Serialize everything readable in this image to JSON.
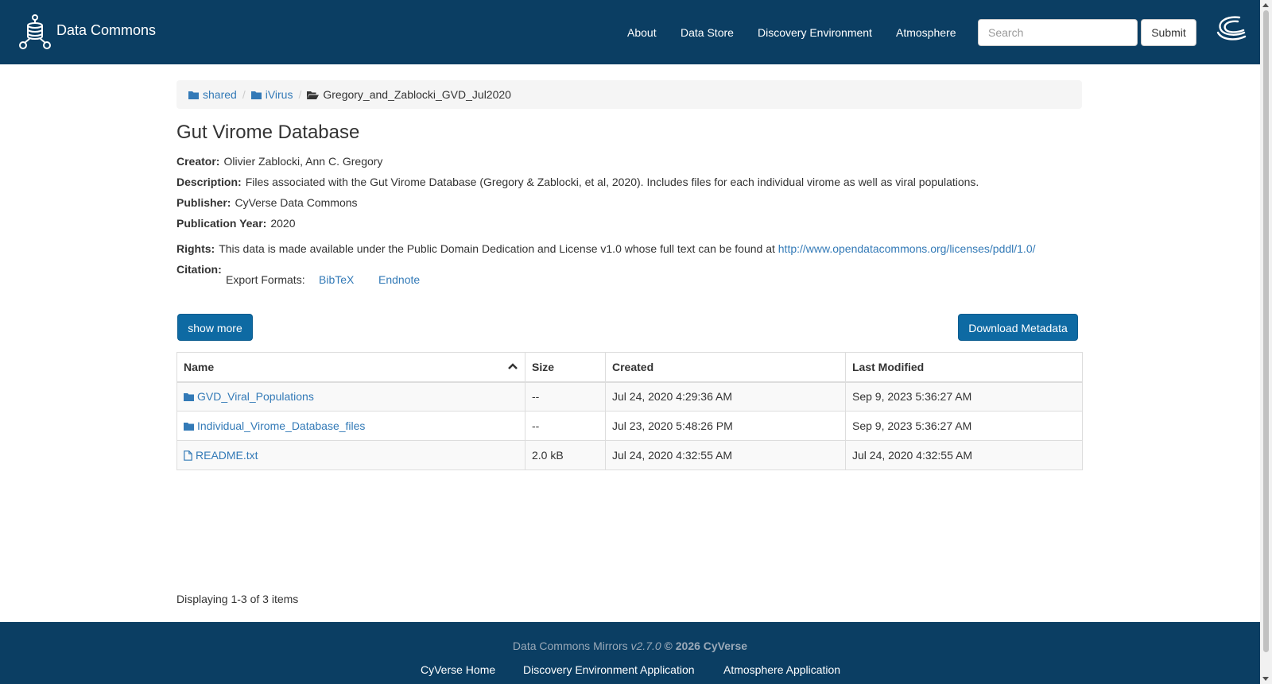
{
  "header": {
    "brand": "Data Commons",
    "nav": [
      "About",
      "Data Store",
      "Discovery Environment",
      "Atmosphere"
    ],
    "search_placeholder": "Search",
    "submit_label": "Submit"
  },
  "breadcrumb": {
    "items": [
      "shared",
      "iVirus"
    ],
    "current": "Gregory_and_Zablocki_GVD_Jul2020"
  },
  "dataset": {
    "title": "Gut Virome Database",
    "creator_label": "Creator:",
    "creator": "Olivier Zablocki, Ann C. Gregory",
    "description_label": "Description:",
    "description": "Files associated with the Gut Virome Database (Gregory & Zablocki, et al, 2020). Includes files for each individual virome as well as viral populations.",
    "publisher_label": "Publisher:",
    "publisher": "CyVerse Data Commons",
    "year_label": "Publication Year:",
    "year": "2020",
    "rights_label": "Rights:",
    "rights_text": "This data is made available under the Public Domain Dedication and License v1.0 whose full text can be found at",
    "rights_link": "http://www.opendatacommons.org/licenses/pddl/1.0/",
    "citation_label": "Citation:",
    "export_label": "Export Formats:",
    "export_formats": [
      "BibTeX",
      "Endnote"
    ]
  },
  "buttons": {
    "show_more": "show more",
    "download_metadata": "Download Metadata"
  },
  "table": {
    "columns": [
      "Name",
      "Size",
      "Created",
      "Last Modified"
    ],
    "rows": [
      {
        "name": "GVD_Viral_Populations",
        "type": "folder",
        "size": "--",
        "created": "Jul 24, 2020 4:29:36 AM",
        "modified": "Sep 9, 2023 5:36:27 AM"
      },
      {
        "name": "Individual_Virome_Database_files",
        "type": "folder",
        "size": "--",
        "created": "Jul 23, 2020 5:48:26 PM",
        "modified": "Sep 9, 2023 5:36:27 AM"
      },
      {
        "name": "README.txt",
        "type": "file",
        "size": "2.0 kB",
        "created": "Jul 24, 2020 4:32:55 AM",
        "modified": "Jul 24, 2020 4:32:55 AM"
      }
    ]
  },
  "displaying": "Displaying 1-3 of 3 items",
  "footer": {
    "app_name": "Data Commons Mirrors",
    "version": "v2.7.0",
    "copyright": "© 2026 CyVerse",
    "links": [
      "CyVerse Home",
      "Discovery Environment Application",
      "Atmosphere Application"
    ]
  },
  "colors": {
    "navbar": "#0b3e63",
    "primary_button": "#0e6aa3",
    "link": "#337ab7"
  }
}
